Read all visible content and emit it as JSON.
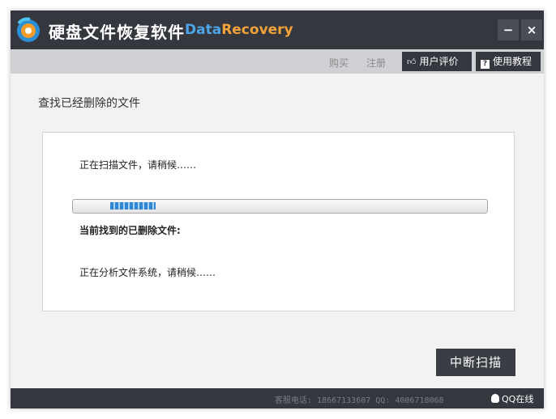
{
  "window": {
    "title_cn": "硬盘文件恢复软件",
    "title_en_part1": "Data",
    "title_en_part2": "Recovery",
    "minimize_label": "−",
    "close_label": "×"
  },
  "toolbar": {
    "buy_label": "购买",
    "register_label": "注册",
    "reviews_label": "用户评价",
    "tutorial_label": "使用教程"
  },
  "main": {
    "section_title": "查找已经删除的文件",
    "scan_status": "正在扫描文件，请稍候……",
    "found_label": "当前找到的已删除文件:",
    "analyze_status": "正在分析文件系统，请稍候……",
    "stop_button": "中断扫描"
  },
  "statusbar": {
    "support": "客服电话: 18667133607 QQ: 4006718068",
    "qq_online": "QQ在线"
  },
  "colors": {
    "titlebar": "#34373e",
    "accent_blue": "#4ea5e6",
    "accent_orange": "#f4a23a"
  },
  "icons": {
    "app_logo": "recovery-logo-icon",
    "reviews": "thumbs-up-icon",
    "tutorial": "help-book-icon",
    "qq": "qq-penguin-icon"
  }
}
